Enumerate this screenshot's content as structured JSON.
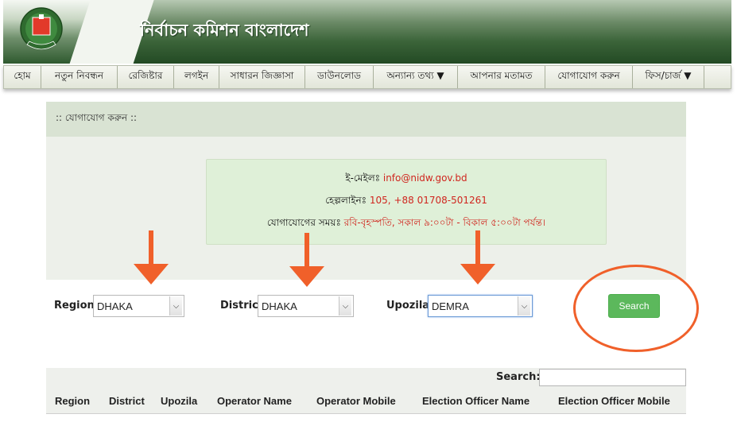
{
  "header": {
    "site_title": "নির্বাচন কমিশন বাংলাদেশ",
    "logo_icon": "ballot-box-emblem-icon"
  },
  "nav": {
    "items": [
      "হোম",
      "নতুন নিবন্ধন",
      "রেজিষ্টার",
      "লগইন",
      "সাধারন জিজ্ঞাসা",
      "ডাউনলোড",
      "অন্যান্য তথ্য ▼",
      "আপনার মতামত",
      "যোগাযোগ করুন",
      "ফিস/চার্জ ▼"
    ]
  },
  "panel": {
    "heading": ":: যোগাযোগ করুন ::",
    "email_label": "ই-মেইলঃ",
    "email_value": "info@nidw.gov.bd",
    "helpline_label": "হেল্পলাইনঃ",
    "helpline_value": "105, +88 01708-501261",
    "hours_label": "যোগাযোগের সময়ঃ",
    "hours_value": "রবি-বৃহস্পতি, সকাল ৯:০০টা - বিকাল ৫:০০টা পর্যন্ত।"
  },
  "filters": {
    "region_label": "Region",
    "region_value": "DHAKA",
    "district_label": "District",
    "district_value": "DHAKA",
    "upozila_label": "Upozila",
    "upozila_value": "DEMRA",
    "search_button": "Search"
  },
  "table": {
    "search_label": "Search:",
    "search_value": "",
    "columns": [
      "Region",
      "District",
      "Upozila",
      "Operator Name",
      "Operator Mobile",
      "Election Officer Name",
      "Election Officer Mobile"
    ]
  },
  "colors": {
    "annotation": "#f0602a",
    "button": "#5cb85c",
    "value_red": "#d0261f"
  }
}
